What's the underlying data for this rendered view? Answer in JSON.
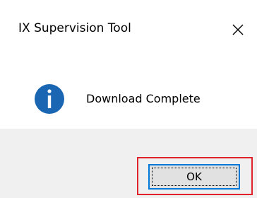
{
  "window": {
    "title": "IX Supervision Tool",
    "close_icon": "close-icon"
  },
  "content": {
    "icon": "info-icon",
    "message": "Download Complete"
  },
  "footer": {
    "ok_label": "OK"
  },
  "colors": {
    "info_icon_fill": "#1a66b3",
    "focus_border": "#0078d7",
    "highlight_border": "#e0222a",
    "footer_background": "#f0f0f0"
  }
}
